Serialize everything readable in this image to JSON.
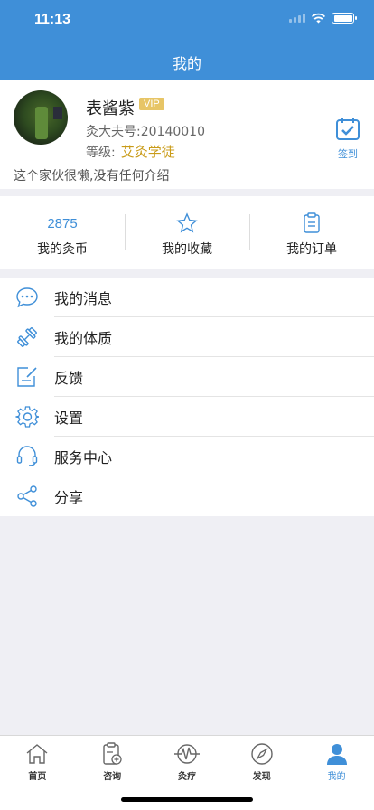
{
  "status_bar": {
    "time": "11:13"
  },
  "header": {
    "title": "我的"
  },
  "profile": {
    "name": "表酱紫",
    "vip_badge": "VIP",
    "account_id": "灸大夫号:20140010",
    "level_label": "等级:",
    "level_value": "艾灸学徒",
    "bio": "这个家伙很懒,没有任何介绍",
    "checkin_label": "签到"
  },
  "stats": {
    "coins_value": "2875",
    "coins_label": "我的灸币",
    "favorites_label": "我的收藏",
    "orders_label": "我的订单"
  },
  "menu": {
    "messages": "我的消息",
    "constitution": "我的体质",
    "feedback": "反馈",
    "settings": "设置",
    "service_center": "服务中心",
    "share": "分享"
  },
  "tabs": {
    "home": "首页",
    "consult": "咨询",
    "therapy": "灸疗",
    "discover": "发现",
    "mine": "我的"
  },
  "colors": {
    "brand": "#3f8fd8",
    "level": "#c99b18",
    "vip": "#e7c566"
  }
}
